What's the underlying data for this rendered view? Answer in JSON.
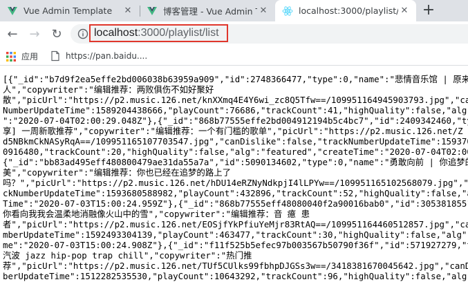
{
  "browser": {
    "tabs": [
      {
        "title": "Vue Admin Template",
        "icon": "vue-icon",
        "active": false
      },
      {
        "title": "博客管理 - Vue Admin T",
        "icon": "vue-icon",
        "active": false
      },
      {
        "title": "localhost:3000/playlist/",
        "icon": "react-icon",
        "active": true
      }
    ],
    "close_glyph": "✕",
    "new_tab_glyph": "+",
    "nav": {
      "back_glyph": "←",
      "forward_glyph": "→",
      "reload_glyph": "↻"
    },
    "address": {
      "host": "localhost",
      "rest": ":3000/playlist/list"
    },
    "bookmarks": [
      {
        "label": "应用",
        "icon": "apps-grid-icon"
      },
      {
        "label": "https://pan.baidu....",
        "icon": "page-icon"
      }
    ],
    "colors": {
      "highlight_border": "#e0362c",
      "tabstrip": "#dee1e6",
      "vue_green": "#41b883",
      "react_blue": "#61dafb"
    }
  },
  "content": {
    "lines": [
      "[{\"_id\":\"b7d9f2ea5effe2bd006038b63959a909\",\"id\":2748366477,\"type\":0,\"name\":\"悲情音乐馆 | 原来所爱",
      "人\",\"copywriter\":\"编辑推荐：两败俱伤不如好聚好",
      "散\",\"picUrl\":\"https://p2.music.126.net/knXXmq4E4Y6wi_zc8Q5Tfw==/109951164945903793.jpg\",\"canDisli",
      "NumberUpdateTime\":1589204438666,\"playCount\":76686,\"trackCount\":41,\"highQuality\":false,\"alg\":\"feat",
      "\":\"2020-07-04T02:00:29.048Z\"},{\"_id\":\"868b77555effe2bd004912194b5c4bc7\",\"id\":2409342460,\"type\":0",
      "享] 一周新歌推荐\",\"copywriter\":\"编辑推荐：一个有门槛的歌单\",\"picUrl\":\"https://p2.music.126.net/Z",
      "d5NBkmCkNASyRqA==/109951165107703547.jpg\",\"canDislike\":false,\"trackNumberUpdateTime\":159370560000",
      "0916480,\"trackCount\":20,\"highQuality\":false,\"alg\":\"featured\",\"createTime\":\"2020-07-04T02:00:29.01",
      "{\"_id\":\"bb83ad495eff480800479ae31da55a7a\",\"id\":5090134602,\"type\":0,\"name\":\"勇敢向前 | 你追梦的样子",
      "美\",\"copywriter\":\"编辑推荐：你也已经在追梦的路上了",
      "吗？\",\"picUrl\":\"https://p2.music.126.net/hDU14eRZNyNdkpjI4lLPYw==/109951165102568079.jpg\",\"canDis",
      "ckNumberUpdateTime\":1593680588982,\"playCount\":432896,\"trackCount\":52,\"highQuality\":false,\"alg\":\"f",
      "Time\":\"2020-07-03T15:00:24.959Z\"},{\"_id\":\"868b77555eff48080040f2a90016bab0\",\"id\":3053818551,\"type",
      "你看向我我会温柔地消融像火山中的雪\",\"copywriter\":\"编辑推荐：音 癔 患",
      "者\",\"picUrl\":\"https://p2.music.126.net/EOSjfYkPfiuYeMjr83RtAQ==/109951164460512857.jpg\",\"canDisli",
      "mberUpdateTime\":1592493304139,\"playCount\":463477,\"trackCount\":30,\"highQuality\":false,\"alg\":\"featu",
      "me\":\"2020-07-03T15:00:24.908Z\"},{\"_id\":\"f11f525b5efec97b003567b50790f36f\",\"id\":571927279,\"type\":0",
      "汽波 jazz hip-pop trap chill\",\"copywriter\":\"热门推",
      "荐\",\"picUrl\":\"https://p2.music.126.net/TUf5CUlks99fbhpDJGSs3w==/3418381670045642.jpg\",\"canDislike",
      "berUpdateTime\":1512282535530,\"playCount\":10643292,\"trackCount\":96,\"highQuality\":false,\"alg\":\"city"
    ]
  }
}
